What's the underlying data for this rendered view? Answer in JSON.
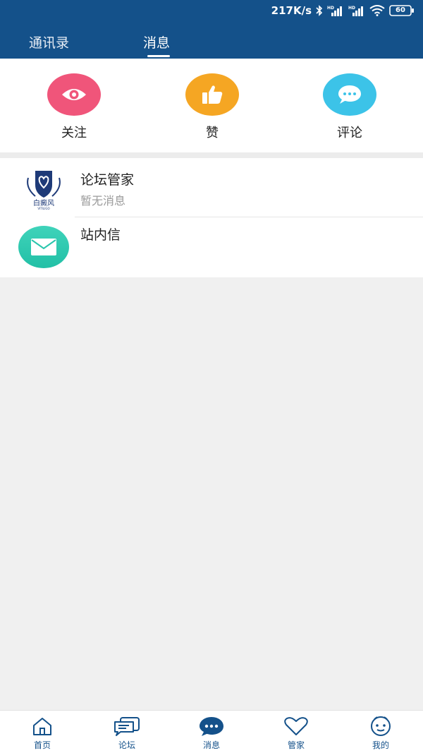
{
  "status_bar": {
    "speed": "217K/s",
    "signal_tag": "HD",
    "battery": "60"
  },
  "top_tabs": [
    {
      "label": "通讯录",
      "active": false
    },
    {
      "label": "消息",
      "active": true
    }
  ],
  "quick_actions": [
    {
      "label": "关注",
      "icon": "eye-icon",
      "color": "#f0557a"
    },
    {
      "label": "赞",
      "icon": "thumbs-up-icon",
      "color": "#f5a623"
    },
    {
      "label": "评论",
      "icon": "chat-bubble-icon",
      "color": "#3cc3e8"
    }
  ],
  "messages": [
    {
      "title": "论坛管家",
      "subtitle": "暂无消息",
      "avatar_text": "白癜风",
      "avatar_subtext": "VITILIGO"
    },
    {
      "title": "站内信",
      "subtitle": "",
      "icon": "envelope-icon"
    }
  ],
  "bottom_nav": [
    {
      "label": "首页",
      "icon": "home-icon"
    },
    {
      "label": "论坛",
      "icon": "forum-icon"
    },
    {
      "label": "消息",
      "icon": "message-icon",
      "active": true
    },
    {
      "label": "管家",
      "icon": "heart-icon"
    },
    {
      "label": "我的",
      "icon": "profile-icon"
    }
  ],
  "colors": {
    "header": "#14518a",
    "accent": "#14518a"
  }
}
